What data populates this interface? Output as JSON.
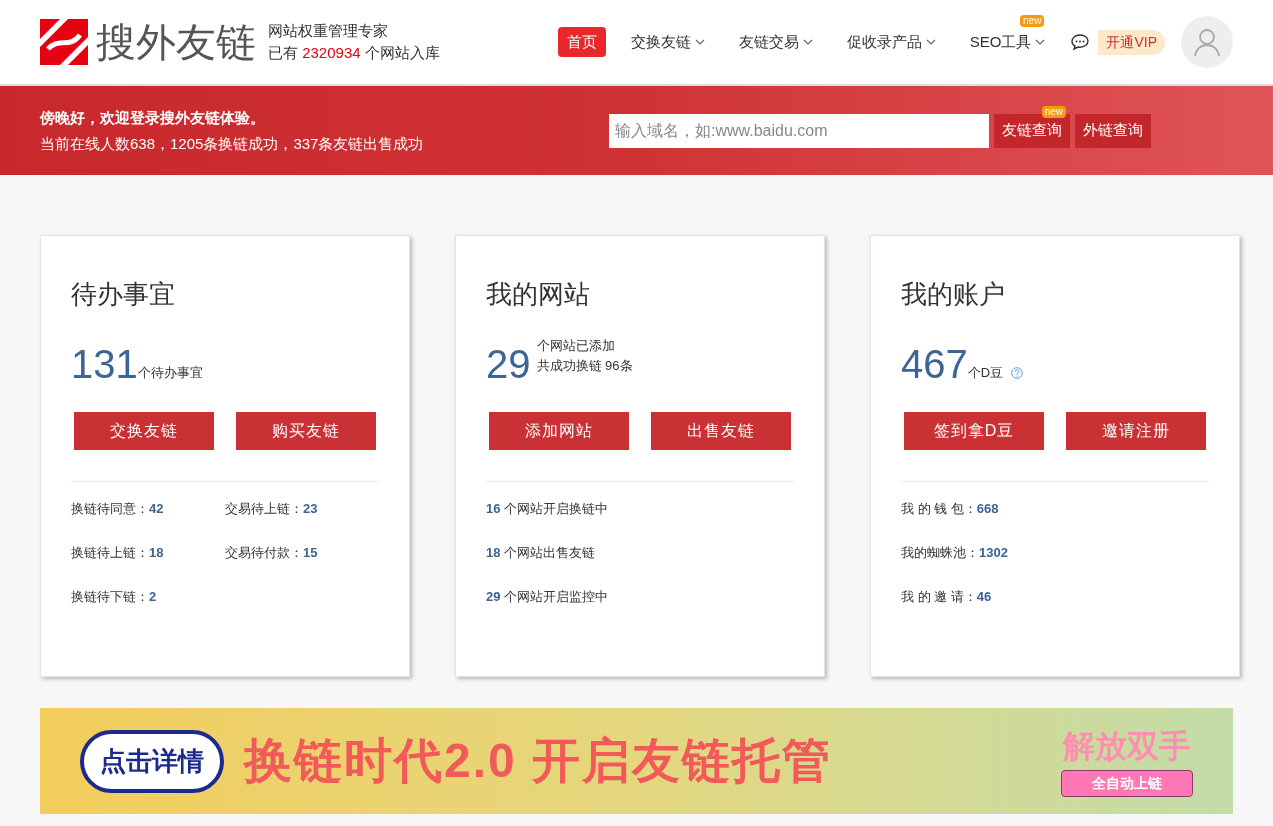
{
  "header": {
    "logo_text": "搜外友链",
    "tagline": "网站权重管理专家",
    "count_prefix": "已有",
    "count": "2320934",
    "count_suffix": "个网站入库",
    "nav": [
      {
        "label": "首页",
        "selected": true,
        "dropdown": false
      },
      {
        "label": "交换友链",
        "selected": false,
        "dropdown": true
      },
      {
        "label": "友链交易",
        "selected": false,
        "dropdown": true
      },
      {
        "label": "促收录产品",
        "selected": false,
        "dropdown": true
      },
      {
        "label": "SEO工具",
        "selected": false,
        "dropdown": true,
        "badge": "new"
      }
    ],
    "vip": "开通VIP"
  },
  "banner": {
    "greeting": "傍晚好，欢迎登录搜外友链体验。",
    "stats": "当前在线人数638，1205条换链成功，337条友链出售成功",
    "search_placeholder": "输入域名，如:www.baidu.com",
    "buttons": [
      {
        "label": "友链查询",
        "badge": "new"
      },
      {
        "label": "外链查询"
      }
    ]
  },
  "cards": [
    {
      "title": "待办事宜",
      "number": "131",
      "captions": [
        "个待办事宜"
      ],
      "help": false,
      "buttons": [
        "交换友链",
        "购买友链"
      ],
      "stats": [
        {
          "kind": "label_first",
          "label": "换链待同意：",
          "value": "42"
        },
        {
          "kind": "label_first",
          "label": "交易待上链：",
          "value": "23"
        },
        {
          "kind": "label_first",
          "label": "换链待上链：",
          "value": "18"
        },
        {
          "kind": "label_first",
          "label": "交易待付款：",
          "value": "15"
        },
        {
          "kind": "label_first",
          "label": "换链待下链：",
          "value": "2"
        }
      ]
    },
    {
      "title": "我的网站",
      "number": "29",
      "captions": [
        "个网站已添加",
        "共成功换链 96条"
      ],
      "help": false,
      "buttons": [
        "添加网站",
        "出售友链"
      ],
      "stats": [
        {
          "kind": "value_first",
          "label": "个网站开启换链中",
          "value": "16"
        },
        {
          "kind": "value_first",
          "label": "个网站出售友链",
          "value": "18"
        },
        {
          "kind": "value_first",
          "label": "个网站开启监控中",
          "value": "29"
        }
      ]
    },
    {
      "title": "我的账户",
      "number": "467",
      "captions": [
        "个D豆"
      ],
      "help": true,
      "buttons": [
        "签到拿D豆",
        "邀请注册"
      ],
      "stats": [
        {
          "kind": "label_first",
          "label": "我 的 钱 包：",
          "value": "668"
        },
        {
          "kind": "label_first",
          "label": "我的蜘蛛池：",
          "value": "1302"
        },
        {
          "kind": "label_first",
          "label": "我 的 邀 请：",
          "value": "46"
        }
      ]
    }
  ],
  "promo": {
    "cloud_text": "点击详情",
    "headline": "换链时代2.0 开启友链托管",
    "side_title": "解放双手",
    "side_button": "全自动上链"
  }
}
